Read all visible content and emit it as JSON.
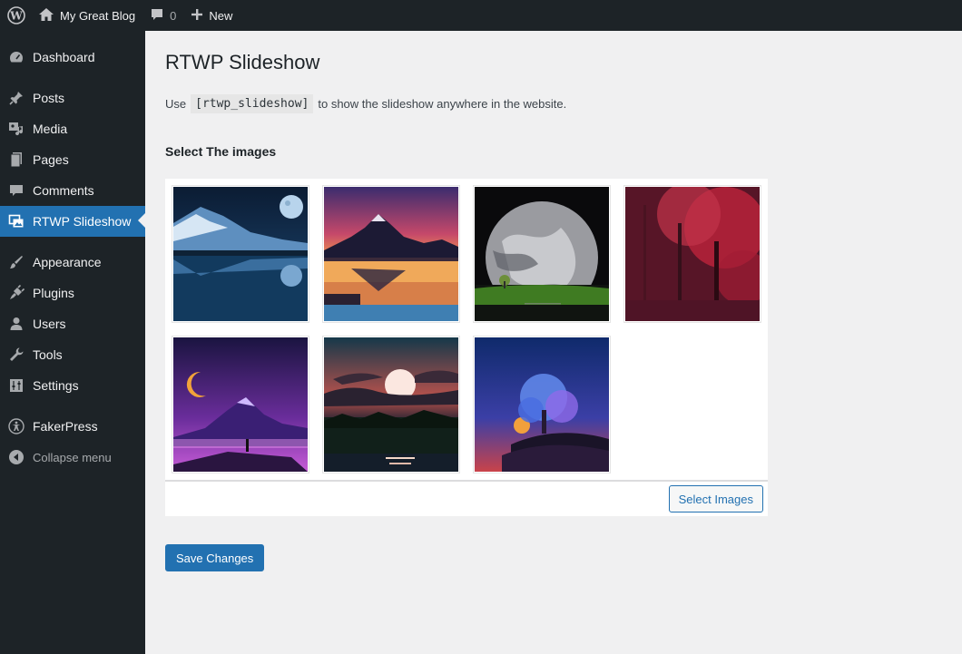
{
  "admin_bar": {
    "site_name": "My Great Blog",
    "comments_count": "0",
    "new_label": "New"
  },
  "sidebar": {
    "items": [
      {
        "label": "Dashboard",
        "icon": "dashboard-icon"
      },
      {
        "label": "Posts",
        "icon": "pin-icon"
      },
      {
        "label": "Media",
        "icon": "media-icon"
      },
      {
        "label": "Pages",
        "icon": "pages-icon"
      },
      {
        "label": "Comments",
        "icon": "comment-icon"
      },
      {
        "label": "RTWP Slideshow",
        "icon": "slideshow-icon",
        "current": true
      },
      {
        "label": "Appearance",
        "icon": "brush-icon"
      },
      {
        "label": "Plugins",
        "icon": "plug-icon"
      },
      {
        "label": "Users",
        "icon": "user-icon"
      },
      {
        "label": "Tools",
        "icon": "wrench-icon"
      },
      {
        "label": "Settings",
        "icon": "settings-icon"
      },
      {
        "label": "FakerPress",
        "icon": "accessibility-icon"
      },
      {
        "label": "Collapse menu",
        "icon": "collapse-icon"
      }
    ]
  },
  "main": {
    "title": "RTWP Slideshow",
    "desc_before": "Use",
    "shortcode": "[rtwp_slideshow]",
    "desc_after": "to show the slideshow anywhere in the website.",
    "section_title": "Select The images",
    "select_button": "Select Images",
    "save_button": "Save Changes"
  },
  "colors": {
    "admin_dark": "#1d2327",
    "accent": "#2271b1",
    "background": "#f0f0f1"
  }
}
